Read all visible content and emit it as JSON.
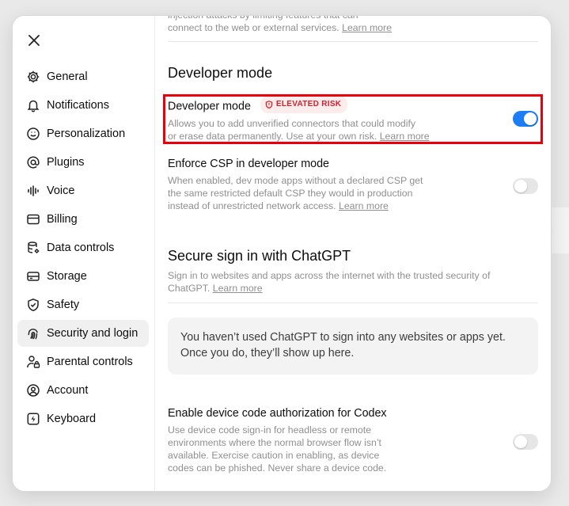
{
  "sidebar": {
    "items": [
      {
        "label": "General",
        "icon": "gear-icon"
      },
      {
        "label": "Notifications",
        "icon": "bell-icon"
      },
      {
        "label": "Personalization",
        "icon": "smile-icon"
      },
      {
        "label": "Plugins",
        "icon": "at-sign-icon"
      },
      {
        "label": "Voice",
        "icon": "waveform-icon"
      },
      {
        "label": "Billing",
        "icon": "credit-card-icon"
      },
      {
        "label": "Data controls",
        "icon": "database-gear-icon"
      },
      {
        "label": "Storage",
        "icon": "drive-icon"
      },
      {
        "label": "Safety",
        "icon": "shield-check-icon"
      },
      {
        "label": "Security and login",
        "icon": "fingerprint-icon"
      },
      {
        "label": "Parental controls",
        "icon": "user-lock-icon"
      },
      {
        "label": "Account",
        "icon": "user-circle-icon"
      },
      {
        "label": "Keyboard",
        "icon": "lightning-icon"
      }
    ],
    "active_index": 9
  },
  "content": {
    "top_fragment": {
      "line1": "injection attacks by limiting features that can",
      "line2": "connect to the web or external services.",
      "link": "Learn more"
    },
    "developer_section_title": "Developer mode",
    "developer_mode": {
      "title": "Developer mode",
      "badge": "ELEVATED RISK",
      "desc1": "Allows you to add unverified connectors that could modify",
      "desc2": "or erase data permanently. Use at your own risk.",
      "link": "Learn more",
      "enabled": true
    },
    "enforce_csp": {
      "title": "Enforce CSP in developer mode",
      "desc1": "When enabled, dev mode apps without a declared CSP get",
      "desc2": "the same restricted default CSP they would in production",
      "desc3": "instead of unrestricted network access.",
      "link": "Learn more",
      "enabled": false
    },
    "secure_signin": {
      "title": "Secure sign in with ChatGPT",
      "desc1": "Sign in to websites and apps across the internet with the trusted security of",
      "desc2": "ChatGPT.",
      "link": "Learn more",
      "empty_line1": "You haven’t used ChatGPT to sign into any websites or apps yet.",
      "empty_line2": "Once you do, they’ll show up here."
    },
    "device_code": {
      "title": "Enable device code authorization for Codex",
      "desc1": "Use device code sign-in for headless or remote",
      "desc2": "environments where the normal browser flow isn’t",
      "desc3": "available. Exercise caution in enabling, as device",
      "desc4": "codes can be phished. Never share a device code.",
      "enabled": false
    }
  },
  "colors": {
    "toggle_on": "#1b7ef5",
    "toggle_off": "#e6e6e6",
    "highlight": "#e8000b",
    "badge_text": "#d2222d",
    "badge_bg": "#fdecec"
  }
}
